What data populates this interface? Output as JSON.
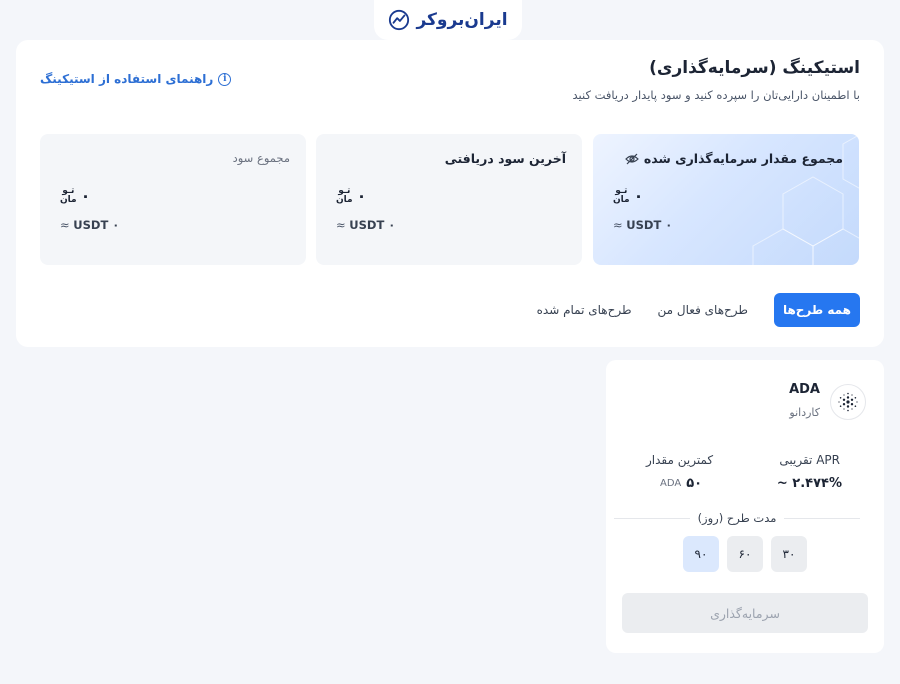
{
  "brand": {
    "logo_text": "ایران‌بروکر"
  },
  "header": {
    "title": "استیکینگ (سرمایه‌گذاری)",
    "subtitle": "با اطمینان دارایی‌تان را سپرده کنید و سود پایدار دریافت کنید",
    "guide_link": "راهنمای استفاده از استیکینگ"
  },
  "stats": [
    {
      "label": "مجموع مقدار سرمایه‌گذاری شده",
      "value": "۰",
      "unit_top": "تـو",
      "unit_bottom": "مان",
      "usdt": "USDT ۰",
      "approx": "≈"
    },
    {
      "label": "آخرین سود دریافتی",
      "value": "۰",
      "unit_top": "تـو",
      "unit_bottom": "مان",
      "usdt": "USDT ۰",
      "approx": "≈"
    },
    {
      "label": "مجموع سود",
      "value": "۰",
      "unit_top": "تـو",
      "unit_bottom": "مان",
      "usdt": "USDT ۰",
      "approx": "≈"
    }
  ],
  "tabs": [
    {
      "label": "همه طرح‌ها",
      "active": true
    },
    {
      "label": "طرح‌های فعال من",
      "active": false
    },
    {
      "label": "طرح‌های تمام شده",
      "active": false
    }
  ],
  "plan": {
    "symbol": "ADA",
    "name": "کاردانو",
    "apr_label": "APR تقریبی",
    "apr_value": "~ ۲.۴۷۴%",
    "min_label": "کمترین مقدار",
    "min_value": "۵۰",
    "min_unit": "ADA",
    "duration_label": "مدت طرح (روز)",
    "durations": [
      {
        "label": "۳۰",
        "selected": false
      },
      {
        "label": "۶۰",
        "selected": false
      },
      {
        "label": "۹۰",
        "selected": true
      }
    ],
    "invest_label": "سرمایه‌گذاری"
  },
  "colors": {
    "primary": "#2677f0",
    "link": "#2d6fd4",
    "brand": "#1a3a8f"
  }
}
